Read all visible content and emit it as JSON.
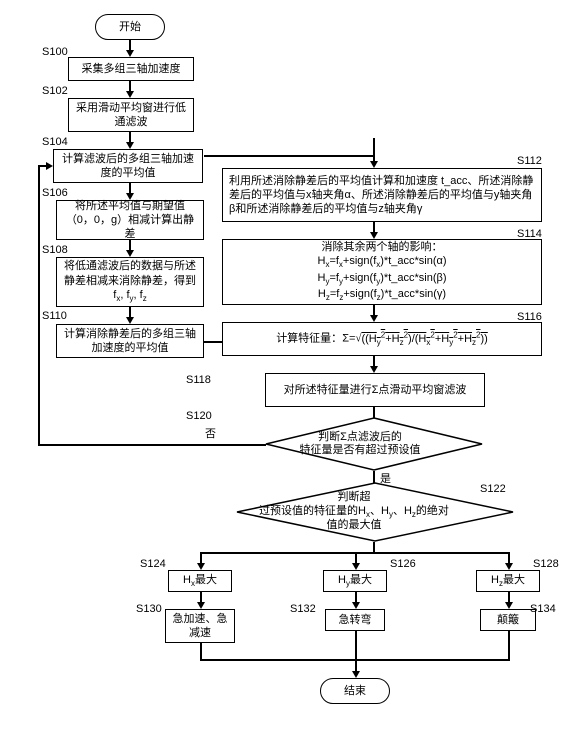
{
  "terminator": {
    "start": "开始",
    "end": "结束"
  },
  "steps": {
    "s100": {
      "label": "S100",
      "text": "采集多组三轴加速度"
    },
    "s102": {
      "label": "S102",
      "text": "采用滑动平均窗进行低通滤波"
    },
    "s104": {
      "label": "S104",
      "text": "计算滤波后的多组三轴加速度的平均值"
    },
    "s106": {
      "label": "S106",
      "text": "将所述平均值与期望值（0，0，g）相减计算出静差"
    },
    "s108": {
      "label": "S108",
      "text": "将低通滤波后的数据与所述静差相减来消除静差，得到 fₓ, f_y, f_z"
    },
    "s110": {
      "label": "S110",
      "text": "计算消除静差后的多组三轴加速度的平均值"
    },
    "s112": {
      "label": "S112",
      "text": "利用所述消除静差后的平均值计算和加速度 t_acc、所述消除静差后的平均值与x轴夹角α、所述消除静差后的平均值与y轴夹角β和所述消除静差后的平均值与z轴夹角γ"
    },
    "s114": {
      "label": "S114",
      "text_title": "消除其余两个轴的影响：",
      "line1": "Hₓ=fₓ+sign(fₓ)*t_acc*sin(α)",
      "line2": "H_y=f_y+sign(f_y)*t_acc*sin(β)",
      "line3": "H_z=f_z+sign(f_z)*t_acc*sin(γ)"
    },
    "s116": {
      "label": "S116",
      "text_prefix": "计算特征量：",
      "formula": "Σ=√((H_y²+H_z²)/(Hₓ²+H_y²+H_z²))"
    },
    "s118": {
      "label": "S118",
      "text": "对所述特征量进行Σ点滑动平均窗滤波"
    },
    "s120": {
      "label": "S120",
      "text": "判断Σ点滤波后的特征量是否有超过预设值",
      "no": "否",
      "yes": "是"
    },
    "s122": {
      "label": "S122",
      "text": "判断超过预设值的特征量的Hₓ、H_y、H_z的绝对值的最大值"
    },
    "s124": {
      "label": "S124",
      "text": "Hₓ最大"
    },
    "s126": {
      "label": "S126",
      "text": "H_y最大"
    },
    "s128": {
      "label": "S128",
      "text": "H_z最大"
    },
    "s130": {
      "label": "S130",
      "text": "急加速、急减速"
    },
    "s132": {
      "label": "S132",
      "text": "急转弯"
    },
    "s134": {
      "label": "S134",
      "text": "颠簸"
    }
  }
}
